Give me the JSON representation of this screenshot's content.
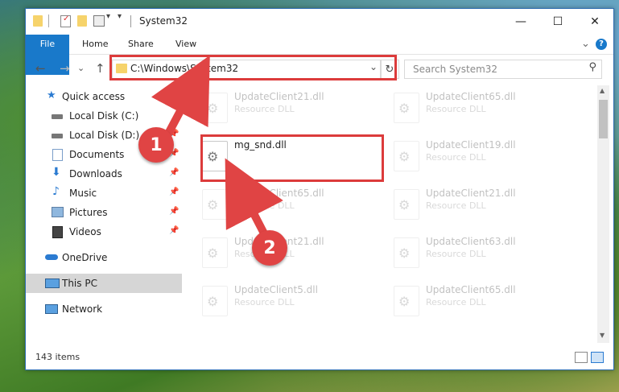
{
  "window": {
    "title": "System32",
    "minimize_glyph": "—",
    "maximize_glyph": "☐",
    "close_glyph": "✕"
  },
  "ribbon": {
    "tabs": [
      "File",
      "Home",
      "Share",
      "View"
    ],
    "collapse_glyph": "⌄",
    "help_glyph": "?"
  },
  "address": {
    "path": "C:\\Windows\\System32",
    "dropdown_glyph": "⌄",
    "refresh_glyph": "↻",
    "back_glyph": "←",
    "forward_glyph": "→",
    "recent_glyph": "⌄",
    "up_glyph": "↑"
  },
  "search": {
    "placeholder": "Search System32",
    "icon_glyph": "⚲"
  },
  "sidebar": {
    "items": [
      {
        "label": "Quick access",
        "icon": "star-icon",
        "pinned": false
      },
      {
        "label": "Local Disk (C:)",
        "icon": "drive-icon",
        "pinned": false
      },
      {
        "label": "Local Disk (D:)",
        "icon": "drive-icon",
        "pinned": true
      },
      {
        "label": "Documents",
        "icon": "documents-icon",
        "pinned": true
      },
      {
        "label": "Downloads",
        "icon": "downloads-icon",
        "pinned": true
      },
      {
        "label": "Music",
        "icon": "music-icon",
        "pinned": true
      },
      {
        "label": "Pictures",
        "icon": "pictures-icon",
        "pinned": true
      },
      {
        "label": "Videos",
        "icon": "videos-icon",
        "pinned": true
      },
      {
        "label": "OneDrive",
        "icon": "onedrive-icon",
        "pinned": false
      },
      {
        "label": "This PC",
        "icon": "pc-icon",
        "pinned": false,
        "selected": true
      },
      {
        "label": "Network",
        "icon": "network-icon",
        "pinned": false
      }
    ],
    "pin_glyph": "📌"
  },
  "files": [
    {
      "name": "UpdateClient21.dll",
      "type": "Resource DLL",
      "faded": true
    },
    {
      "name": "UpdateClient65.dll",
      "type": "Resource DLL",
      "faded": true
    },
    {
      "name": "mg_snd.dll",
      "type": "",
      "faded": false
    },
    {
      "name": "UpdateClient19.dll",
      "type": "Resource DLL",
      "faded": true
    },
    {
      "name": "UpdateClient65.dll",
      "type": "Resource DLL",
      "faded": true
    },
    {
      "name": "UpdateClient21.dll",
      "type": "Resource DLL",
      "faded": true
    },
    {
      "name": "UpdateClient21.dll",
      "type": "Resource DLL",
      "faded": true
    },
    {
      "name": "UpdateClient63.dll",
      "type": "Resource DLL",
      "faded": true
    },
    {
      "name": "UpdateClient5.dll",
      "type": "Resource DLL",
      "faded": true
    },
    {
      "name": "UpdateClient65.dll",
      "type": "Resource DLL",
      "faded": true
    }
  ],
  "file_icon_glyph": "⚙",
  "status": {
    "item_count": "143 items"
  },
  "annotations": {
    "step1": "1",
    "step2": "2",
    "highlight_color": "#dc3b3b"
  },
  "colors": {
    "accent": "#1979ca",
    "selection": "#d6d6d6"
  }
}
